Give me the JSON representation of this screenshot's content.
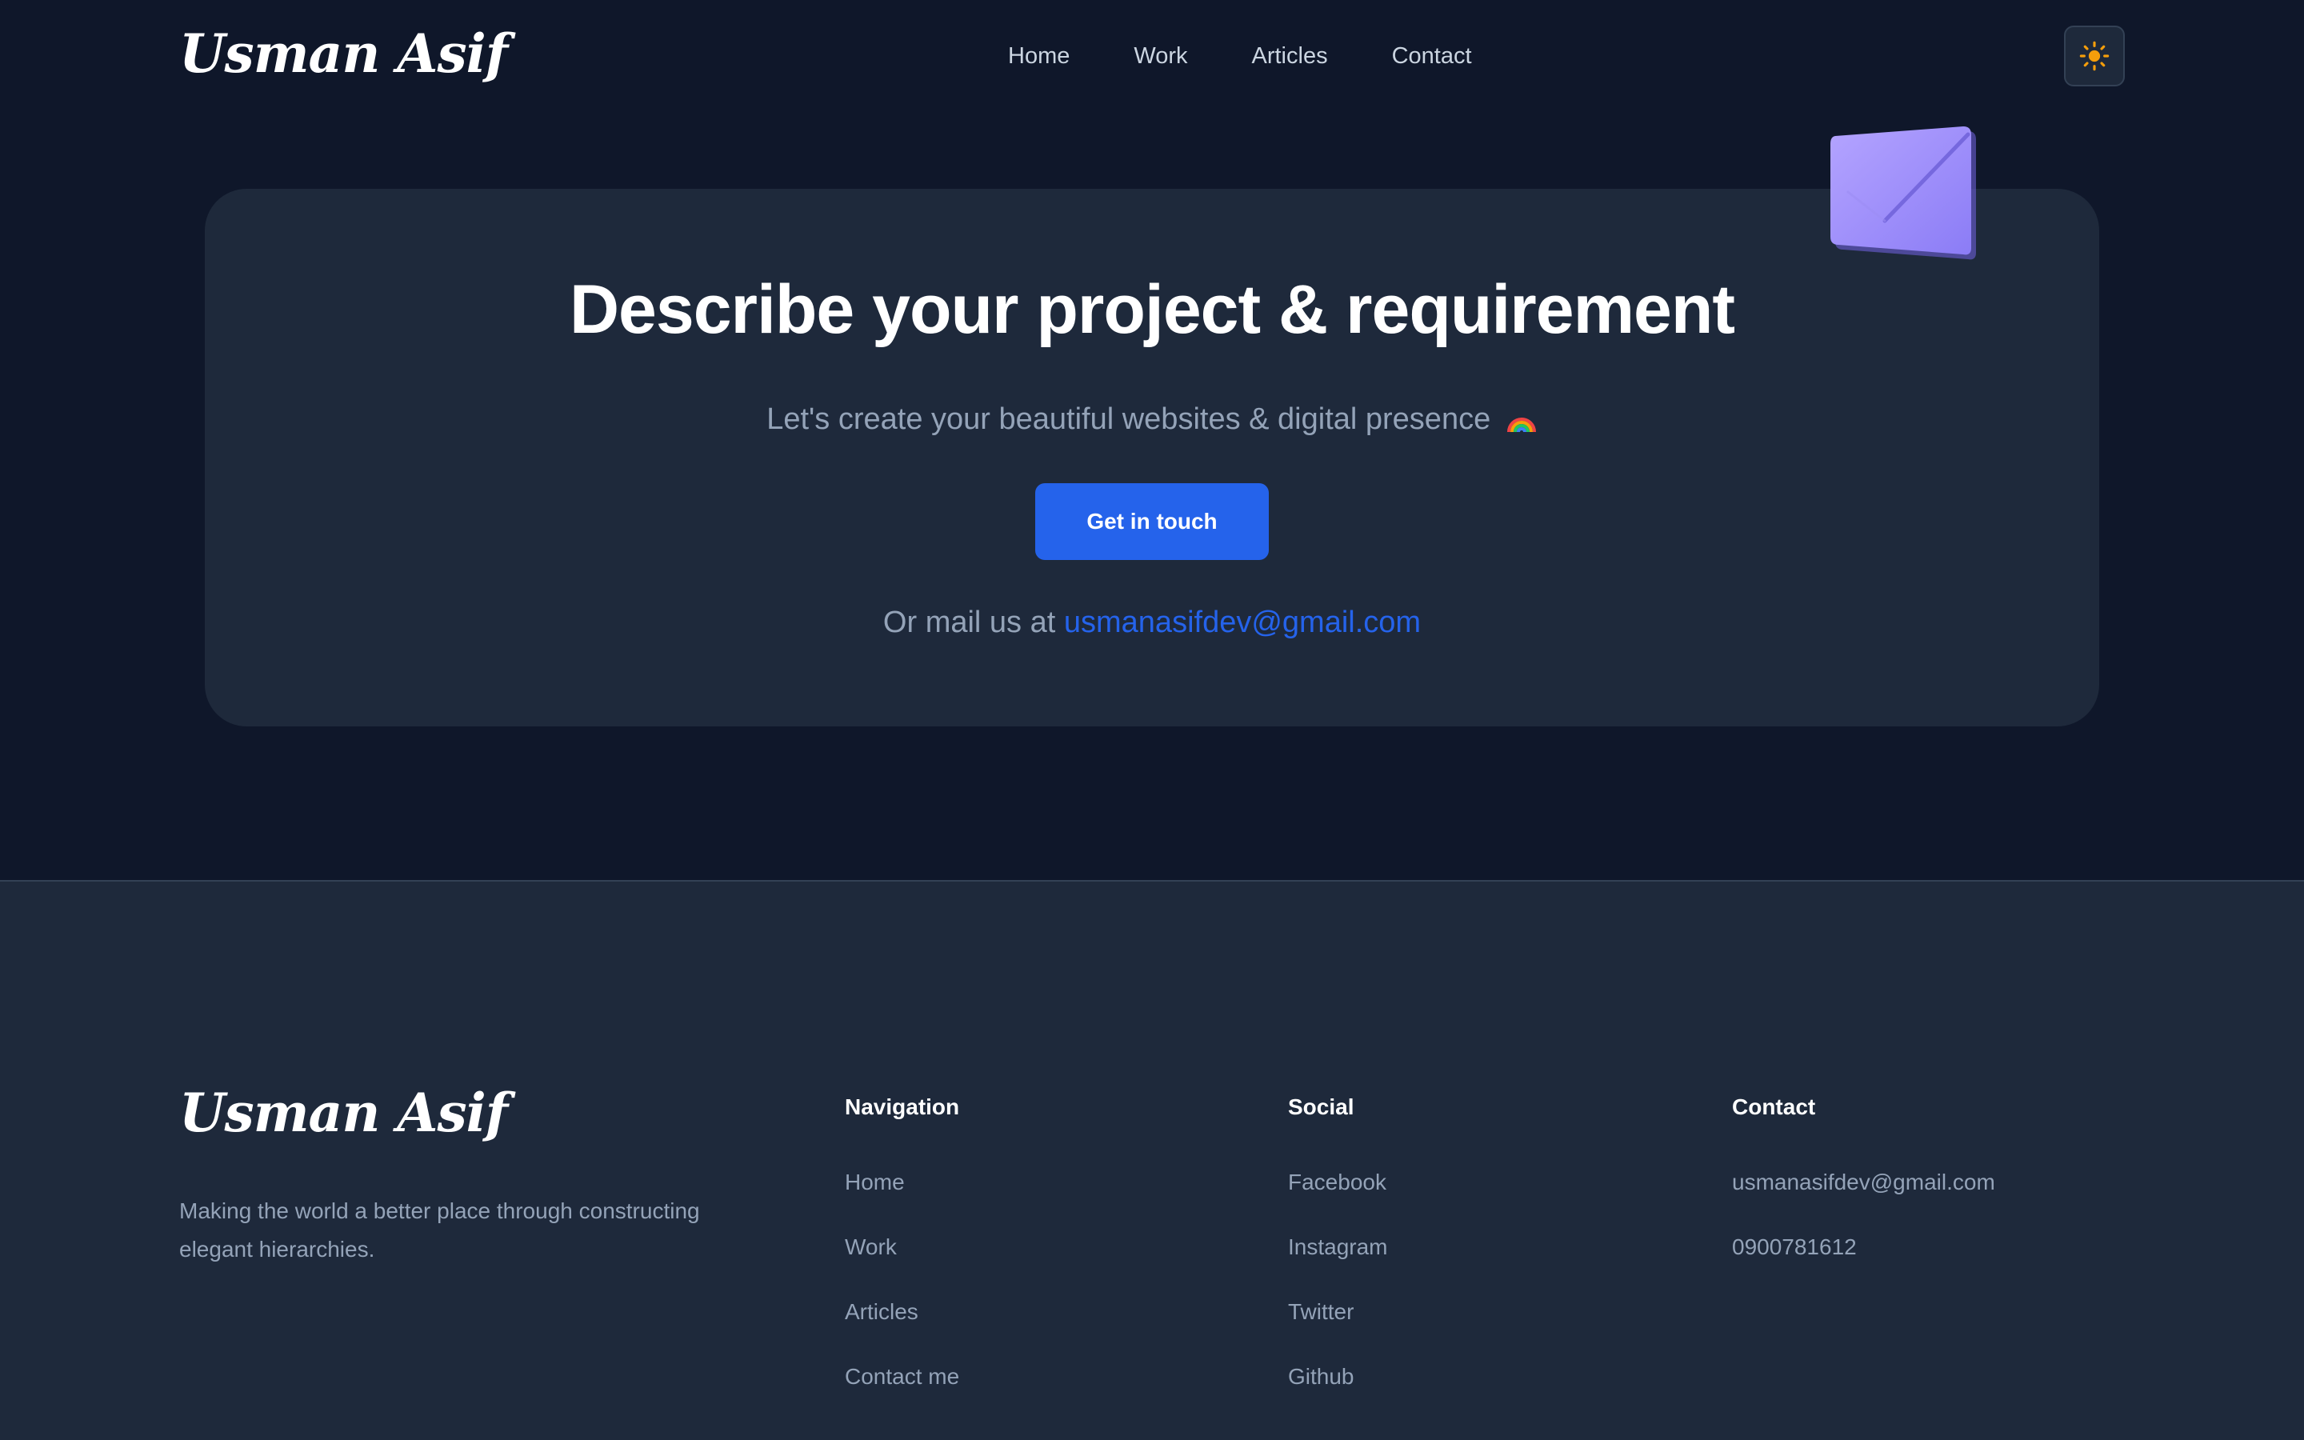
{
  "header": {
    "logo": "Usman Asif",
    "nav": [
      "Home",
      "Work",
      "Articles",
      "Contact"
    ]
  },
  "cta": {
    "title": "Describe your project & requirement",
    "subtitle": "Let's create your beautiful websites & digital presence",
    "button_label": "Get in touch",
    "mail_prefix": "Or mail us at",
    "email": "usmanasifdev@gmail.com"
  },
  "footer": {
    "logo": "Usman Asif",
    "tagline": "Making the world a better place through constructing elegant hierarchies.",
    "navigation": {
      "heading": "Navigation",
      "links": [
        "Home",
        "Work",
        "Articles",
        "Contact me"
      ]
    },
    "social": {
      "heading": "Social",
      "links": [
        "Facebook",
        "Instagram",
        "Twitter",
        "Github"
      ]
    },
    "contact": {
      "heading": "Contact",
      "email": "usmanasifdev@gmail.com",
      "phone": "0900781612"
    }
  },
  "icons": {
    "theme_toggle": "sun-icon",
    "subtitle_emoji": "rainbow-icon",
    "decor": "envelope-icon"
  },
  "colors": {
    "background": "#0f172a",
    "surface": "#1e293b",
    "accent": "#2563eb",
    "muted_text": "#94a3b8",
    "sun": "#f59e0b",
    "envelope": "#a78bfa"
  }
}
